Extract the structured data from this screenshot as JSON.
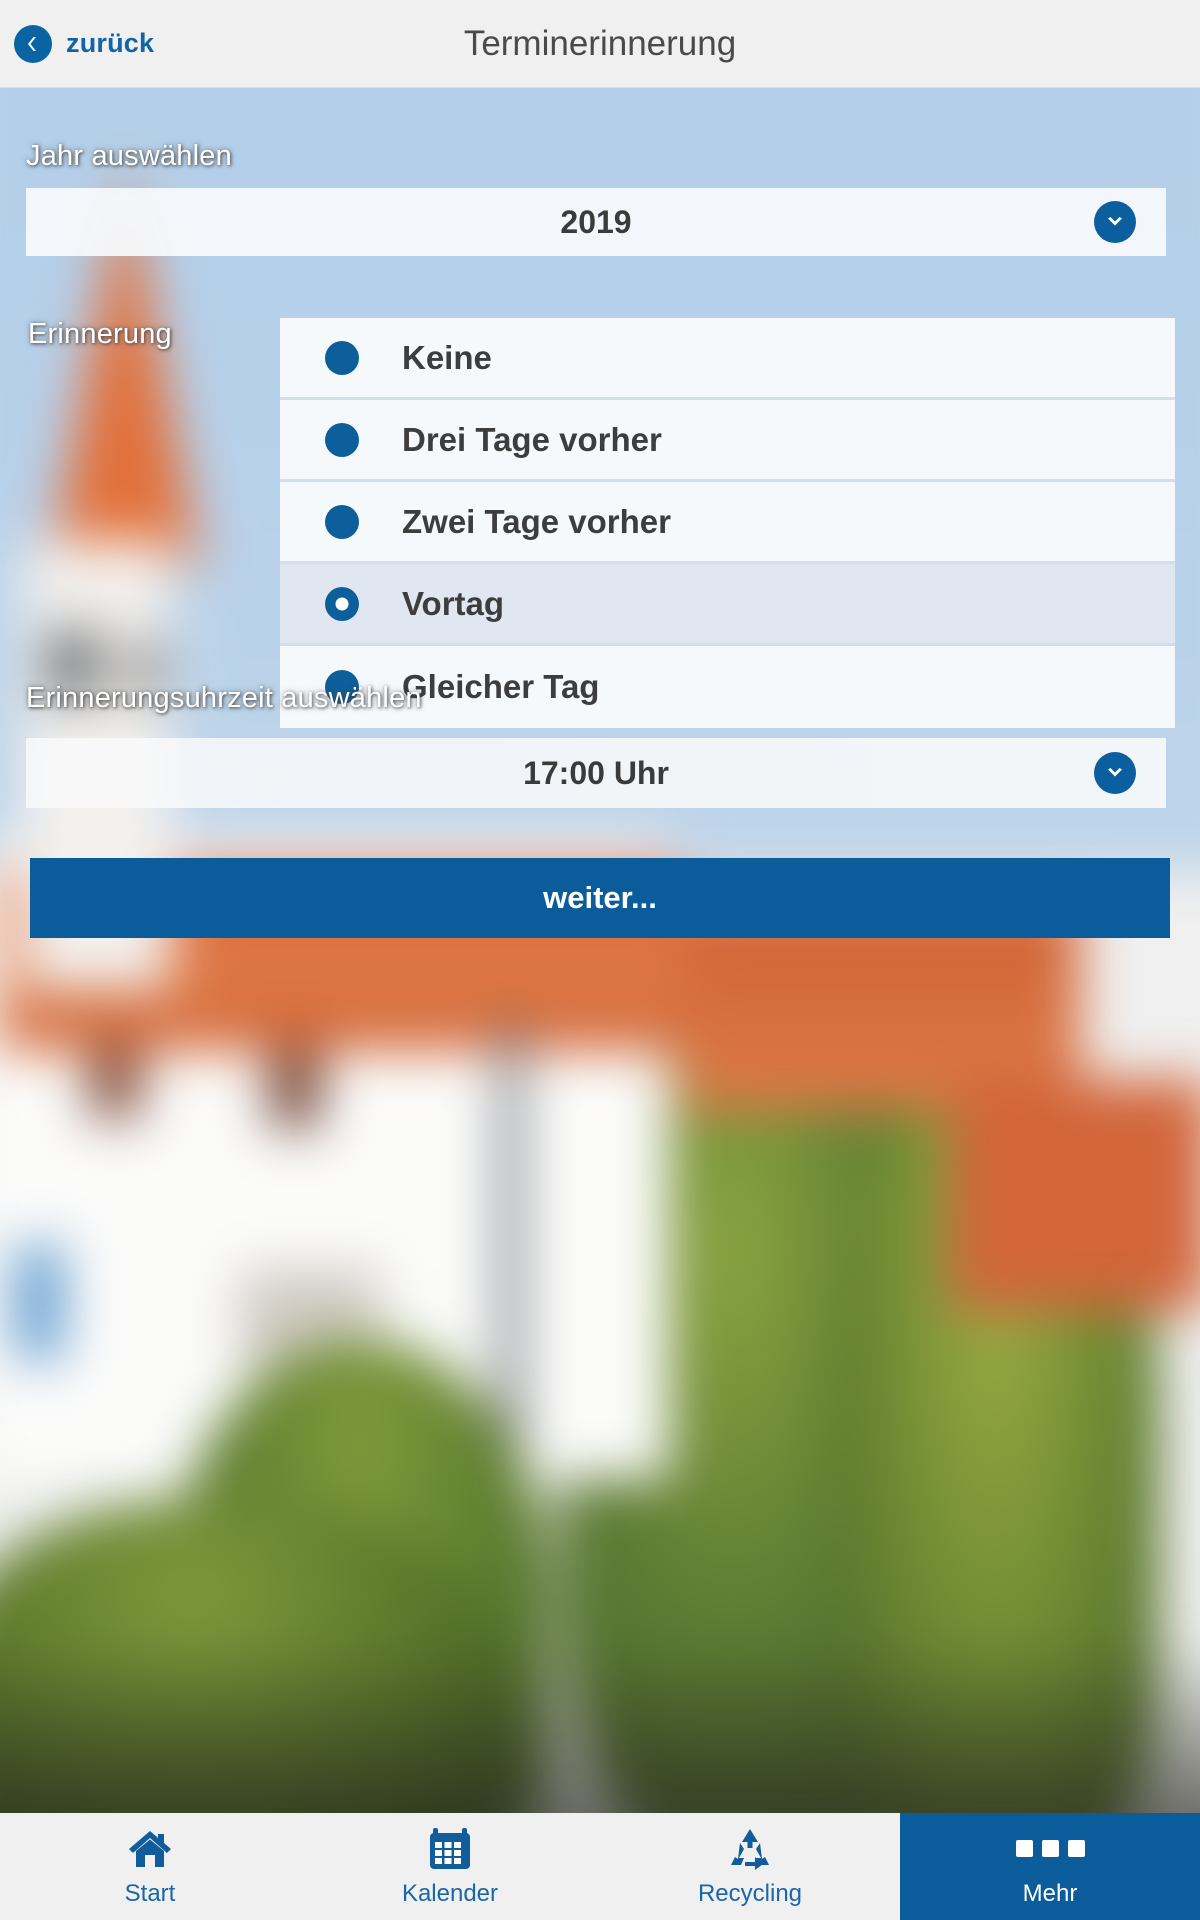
{
  "header": {
    "back_label": "zurück",
    "back_icon": "chevron-left-icon",
    "title": "Terminerinnerung"
  },
  "form": {
    "year": {
      "label": "Jahr auswählen",
      "value": "2019",
      "dropdown_icon": "chevron-down-icon"
    },
    "reminder": {
      "label": "Erinnerung",
      "options": [
        {
          "label": "Keine",
          "selected": false
        },
        {
          "label": "Drei Tage vorher",
          "selected": false
        },
        {
          "label": "Zwei Tage vorher",
          "selected": false
        },
        {
          "label": "Vortag",
          "selected": true
        },
        {
          "label": "Gleicher Tag",
          "selected": false
        }
      ]
    },
    "time": {
      "label": "Erinnerungsuhrzeit auswählen",
      "value": "17:00 Uhr",
      "dropdown_icon": "chevron-down-icon"
    },
    "submit_label": "weiter..."
  },
  "tabbar": {
    "items": [
      {
        "label": "Start",
        "icon": "home-icon",
        "active": false
      },
      {
        "label": "Kalender",
        "icon": "calendar-icon",
        "active": false
      },
      {
        "label": "Recycling",
        "icon": "recycling-icon",
        "active": false
      },
      {
        "label": "Mehr",
        "icon": "ellipsis-icon",
        "active": true
      }
    ]
  },
  "colors": {
    "accent": "#0b5c9b",
    "header_bg": "#f0f0f0",
    "radio_blue": "#0d5f9c",
    "label_white": "#ffffff"
  }
}
